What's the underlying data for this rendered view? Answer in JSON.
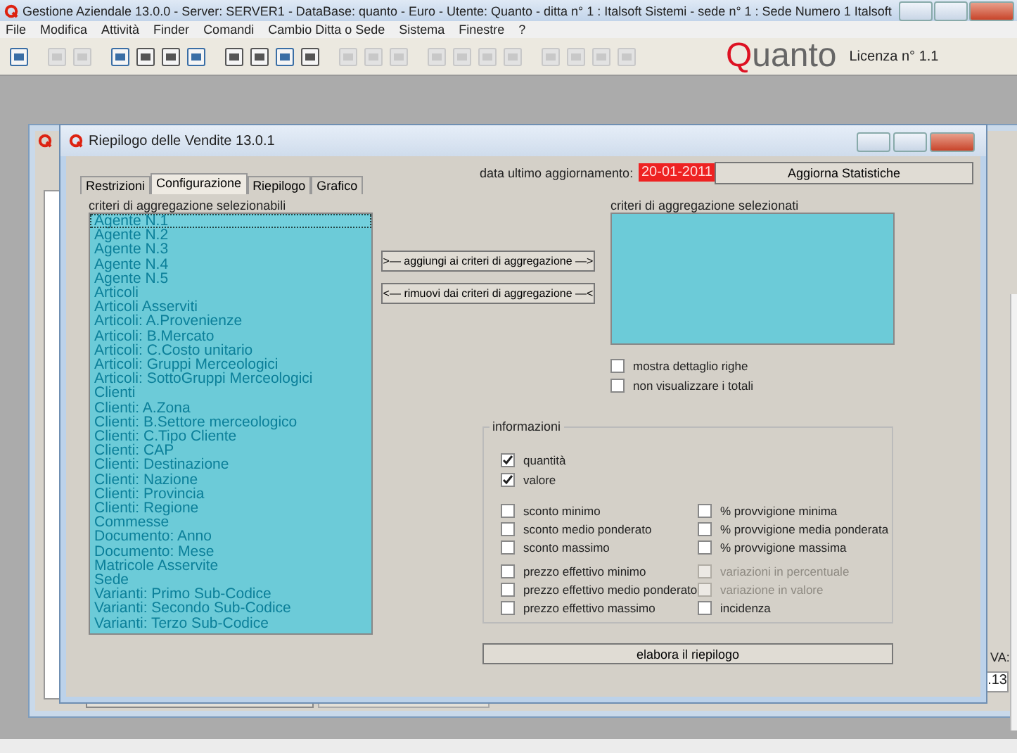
{
  "window": {
    "title": "Gestione Aziendale 13.0.0 - Server: SERVER1 - DataBase: quanto - Euro - Utente: Quanto - ditta n° 1 : Italsoft Sistemi - sede n° 1 : Sede Numero 1 Italsoft"
  },
  "menu": [
    "File",
    "Modifica",
    "Attività",
    "Finder",
    "Comandi",
    "Cambio Ditta o Sede",
    "Sistema",
    "Finestre",
    "?"
  ],
  "toolbar": [
    {
      "disabled": false
    },
    {
      "disabled": true
    },
    {
      "disabled": true
    },
    {
      "disabled": false
    },
    {
      "disabled": false
    },
    {
      "disabled": false
    },
    {
      "disabled": false
    },
    {
      "disabled": false
    },
    {
      "disabled": false
    },
    {
      "disabled": false
    },
    {
      "disabled": false
    },
    {
      "disabled": true
    },
    {
      "disabled": true
    },
    {
      "disabled": true
    },
    {
      "disabled": true
    },
    {
      "disabled": true
    },
    {
      "disabled": true
    },
    {
      "disabled": true
    },
    {
      "disabled": true
    },
    {
      "disabled": true
    },
    {
      "disabled": true
    },
    {
      "disabled": true
    }
  ],
  "logo": "Quanto",
  "license": "Licenza n° 1.1",
  "background_window": {
    "field_label": "VA:",
    "field_value": ".13"
  },
  "dialog": {
    "title": "Riepilogo delle Vendite 13.0.1",
    "tabs": [
      {
        "label": "Restrizioni",
        "selected": false
      },
      {
        "label": "Configurazione",
        "selected": true
      },
      {
        "label": "Riepilogo",
        "selected": false
      },
      {
        "label": "Grafico",
        "selected": false
      }
    ],
    "date_label": "data ultimo aggiornamento:",
    "date_value": "20-01-2011",
    "update_button": "Aggiorna Statistiche",
    "available_label": "criteri di aggregazione selezionabili",
    "available": [
      {
        "label": "Agente N.1",
        "selected": true
      },
      {
        "label": "Agente N.2",
        "selected": false
      },
      {
        "label": "Agente N.3",
        "selected": false
      },
      {
        "label": "Agente N.4",
        "selected": false
      },
      {
        "label": "Agente N.5",
        "selected": false
      },
      {
        "label": "Articoli",
        "selected": false
      },
      {
        "label": "Articoli Asserviti",
        "selected": false
      },
      {
        "label": "Articoli: A.Provenienze",
        "selected": false
      },
      {
        "label": "Articoli: B.Mercato",
        "selected": false
      },
      {
        "label": "Articoli: C.Costo unitario",
        "selected": false
      },
      {
        "label": "Articoli: Gruppi Merceologici",
        "selected": false
      },
      {
        "label": "Articoli: SottoGruppi Merceologici",
        "selected": false
      },
      {
        "label": "Clienti",
        "selected": false
      },
      {
        "label": "Clienti: A.Zona",
        "selected": false
      },
      {
        "label": "Clienti: B.Settore merceologico",
        "selected": false
      },
      {
        "label": "Clienti: C.Tipo Cliente",
        "selected": false
      },
      {
        "label": "Clienti: CAP",
        "selected": false
      },
      {
        "label": "Clienti: Destinazione",
        "selected": false
      },
      {
        "label": "Clienti: Nazione",
        "selected": false
      },
      {
        "label": "Clienti: Provincia",
        "selected": false
      },
      {
        "label": "Clienti: Regione",
        "selected": false
      },
      {
        "label": "Commesse",
        "selected": false
      },
      {
        "label": "Documento: Anno",
        "selected": false
      },
      {
        "label": "Documento: Mese",
        "selected": false
      },
      {
        "label": "Matricole Asservite",
        "selected": false
      },
      {
        "label": "Sede",
        "selected": false
      },
      {
        "label": "Varianti: Primo Sub-Codice",
        "selected": false
      },
      {
        "label": "Varianti: Secondo Sub-Codice",
        "selected": false
      },
      {
        "label": "Varianti: Terzo Sub-Codice",
        "selected": false
      }
    ],
    "add_button": ">— aggiungi ai criteri di aggregazione —>",
    "remove_button": "<— rimuovi dai criteri di aggregazione —<",
    "selected_label": "criteri di aggregazione selezionati",
    "options": [
      {
        "label": "mostra dettaglio righe",
        "checked": false
      },
      {
        "label": "non visualizzare i totali",
        "checked": false
      }
    ],
    "info_group": {
      "title": "informazioni",
      "main": [
        {
          "label": "quantità",
          "checked": true
        },
        {
          "label": "valore",
          "checked": true
        }
      ],
      "left": [
        [
          {
            "label": "sconto minimo",
            "checked": false
          },
          {
            "label": "sconto medio ponderato",
            "checked": false
          },
          {
            "label": "sconto massimo",
            "checked": false
          }
        ],
        [
          {
            "label": "prezzo effettivo minimo",
            "checked": false
          },
          {
            "label": "prezzo effettivo medio ponderato",
            "checked": false
          },
          {
            "label": "prezzo effettivo massimo",
            "checked": false
          }
        ]
      ],
      "right": [
        [
          {
            "label": "% provvigione minima",
            "checked": false
          },
          {
            "label": "% provvigione media ponderata",
            "checked": false
          },
          {
            "label": "% provvigione massima",
            "checked": false
          }
        ],
        [
          {
            "label": "variazioni in percentuale",
            "checked": false,
            "disabled": true
          },
          {
            "label": "variazione in valore",
            "checked": false,
            "disabled": true
          },
          {
            "label": "incidenza",
            "checked": false,
            "disabled": false
          }
        ]
      ]
    },
    "run_button": "elabora il riepilogo"
  }
}
